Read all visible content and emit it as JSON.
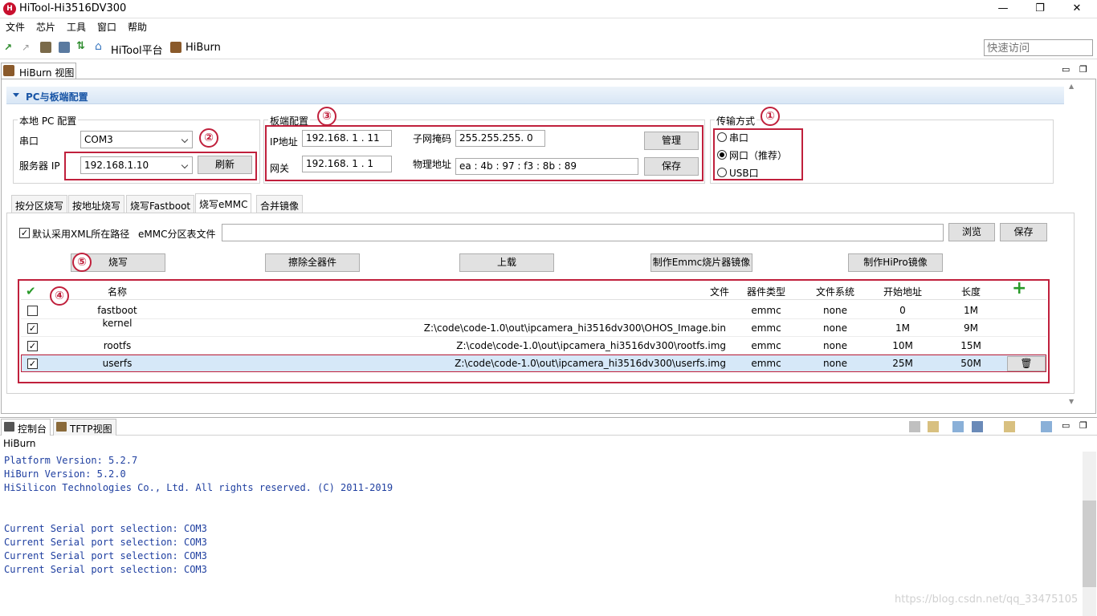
{
  "window": {
    "title": "HiTool-Hi3516DV300",
    "minimize": "—",
    "maximize": "❐",
    "close": "✕"
  },
  "menu": [
    "文件",
    "芯片",
    "工具",
    "窗口",
    "帮助"
  ],
  "toolbar": {
    "hitool_platform": "HiTool平台",
    "hiburn": "HiBurn",
    "quick_access_placeholder": "快速访问"
  },
  "view": {
    "tab_label": "HiBurn 视图",
    "section_title": "PC与板端配置"
  },
  "local_pc": {
    "group_label": "本地 PC 配置",
    "serial_label": "串口",
    "serial_value": "COM3",
    "server_ip_label": "服务器 IP",
    "server_ip_value": "192.168.1.10",
    "refresh_button": "刷新"
  },
  "board": {
    "group_label": "板端配置",
    "ip_label": "IP地址",
    "ip_value": "192.168. 1 . 11",
    "mask_label": "子网掩码",
    "mask_value": "255.255.255. 0",
    "gateway_label": "网关",
    "gateway_value": "192.168. 1 . 1",
    "mac_label": "物理地址",
    "mac_value": "ea : 4b : 97 : f3 : 8b : 89",
    "manage_button": "管理",
    "save_button": "保存"
  },
  "transfer": {
    "group_label": "传输方式",
    "options": [
      "串口",
      "网口（推荐）",
      "USB口"
    ],
    "selected": "网口（推荐）"
  },
  "markers": [
    "①",
    "②",
    "③",
    "④",
    "⑤"
  ],
  "tabs": [
    "按分区烧写",
    "按地址烧写",
    "烧写Fastboot",
    "烧写eMMC",
    "合并镜像"
  ],
  "active_tab": "烧写eMMC",
  "emmc": {
    "xml_checkbox_label": "默认采用XML所在路径",
    "xml_checked": true,
    "partition_label": "eMMC分区表文件",
    "partition_value": "",
    "browse_button": "浏览",
    "save_button": "保存"
  },
  "actions": [
    "烧写",
    "擦除全器件",
    "上载",
    "制作Emmc烧片器镜像",
    "制作HiPro镜像"
  ],
  "table": {
    "headers": {
      "check": "✔",
      "name": "名称",
      "file": "文件",
      "device": "器件类型",
      "fs": "文件系统",
      "start": "开始地址",
      "length": "长度",
      "add": "+"
    },
    "rows": [
      {
        "checked": false,
        "name": "fastboot",
        "file": "",
        "device": "emmc",
        "fs": "none",
        "start": "0",
        "length": "1M"
      },
      {
        "checked": true,
        "name": "kernel",
        "file": "Z:\\code\\code-1.0\\out\\ipcamera_hi3516dv300\\OHOS_Image.bin",
        "device": "emmc",
        "fs": "none",
        "start": "1M",
        "length": "9M"
      },
      {
        "checked": true,
        "name": "rootfs",
        "file": "Z:\\code\\code-1.0\\out\\ipcamera_hi3516dv300\\rootfs.img",
        "device": "emmc",
        "fs": "none",
        "start": "10M",
        "length": "15M"
      },
      {
        "checked": true,
        "name": "userfs",
        "file": "Z:\\code\\code-1.0\\out\\ipcamera_hi3516dv300\\userfs.img",
        "device": "emmc",
        "fs": "none",
        "start": "25M",
        "length": "50M"
      }
    ],
    "delete_icon": "🗑"
  },
  "console": {
    "tabs": [
      "控制台",
      "TFTP视图"
    ],
    "label": "HiBurn",
    "lines": [
      "Platform Version: 5.2.7",
      "HiBurn Version: 5.2.0",
      "HiSilicon Technologies Co., Ltd. All rights reserved. (C) 2011-2019",
      "",
      "",
      "Current Serial port selection: COM3",
      "Current Serial port selection: COM3",
      "Current Serial port selection: COM3",
      "Current Serial port selection: COM3"
    ]
  },
  "watermark": "https://blog.csdn.net/qq_33475105",
  "colors": {
    "accent": "#1a56a6",
    "marker": "#c0203c",
    "console_text": "#1f3fa0",
    "selected_row": "#d6e8f8"
  }
}
